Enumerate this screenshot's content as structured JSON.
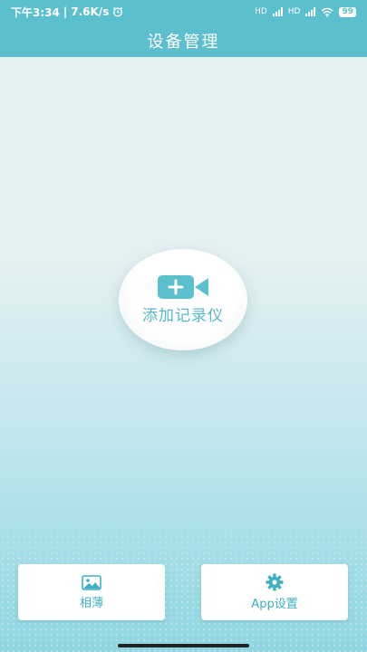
{
  "status_bar": {
    "time": "下午3:34",
    "net_speed": "7.6K/s",
    "separator": "|",
    "signal_label_1": "HD",
    "signal_label_2": "HD",
    "battery": "99"
  },
  "header": {
    "title": "设备管理"
  },
  "main": {
    "add_recorder_label": "添加记录仪"
  },
  "bottom_bar": {
    "album_label": "相薄",
    "settings_label": "App设置"
  },
  "colors": {
    "accent": "#5cbfcd",
    "text_accent": "#3fb0c2",
    "background": "#e6f1f3"
  },
  "icons": [
    "alarm-icon",
    "signal-icon",
    "wifi-icon",
    "battery-icon",
    "video-camera-plus-icon",
    "image-icon",
    "gear-icon"
  ]
}
